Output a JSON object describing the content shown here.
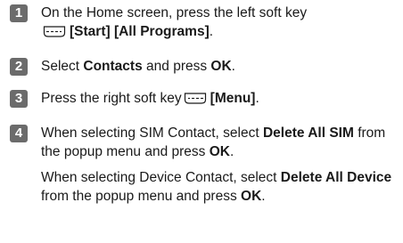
{
  "steps": [
    {
      "number": "1",
      "text_a": "On the Home screen, press the left soft key",
      "bracket_label": "[Start] [All Programs]",
      "text_b": "."
    },
    {
      "number": "2",
      "text_a": "Select ",
      "bold_1": "Contacts",
      "text_b": " and press ",
      "bold_2": "OK",
      "text_c": "."
    },
    {
      "number": "3",
      "text_a": "Press the right soft key",
      "bracket_label": "[Menu]",
      "text_b": "."
    },
    {
      "number": "4",
      "p1_text_a": "When selecting SIM Contact, select ",
      "p1_bold_1": "Delete All SIM",
      "p1_text_b": " from the popup menu and press ",
      "p1_bold_2": "OK",
      "p1_text_c": ".",
      "p2_text_a": "When selecting Device Contact, select ",
      "p2_bold_1": "Delete All Device",
      "p2_text_b": " from the popup menu and press ",
      "p2_bold_2": "OK",
      "p2_text_c": "."
    }
  ],
  "icons": {
    "left_soft_key": "left-soft-key-icon",
    "right_soft_key": "right-soft-key-icon"
  },
  "colors": {
    "step_badge": "#6b6b6b",
    "text": "#1a1a1a"
  }
}
